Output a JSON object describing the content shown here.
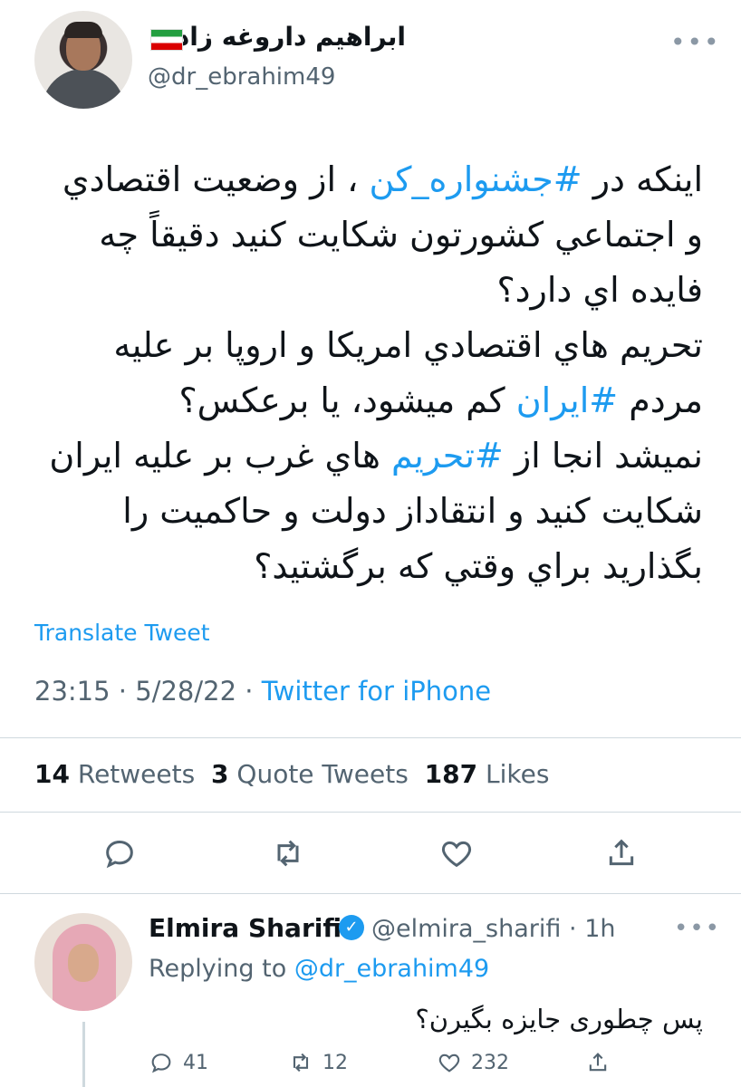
{
  "tweet": {
    "display_name": "ابراهیم داروغه زاده",
    "handle": "@dr_ebrahim49",
    "text_line1_pre": "اینکه در ",
    "hashtag1": "#جشنواره_کن",
    "text_line1_post": " ، از وضعیت اقتصادي",
    "text_line2": "و اجتماعي کشورتون شکایت کنید دقیقاً چه",
    "text_line3": "فایده اي دارد؟",
    "text_line4": "تحریم هاي اقتصادي امریکا و اروپا بر علیه",
    "text_line5_pre": "مردم ",
    "hashtag2": "#ایران",
    "text_line5_post": " کم میشود، یا برعکس؟",
    "text_line6_pre": "نمیشد انجا از ",
    "hashtag3": "#تحریم",
    "text_line6_post": " هاي غرب بر علیه ایران",
    "text_line7": "شکایت کنید و انتقاداز دولت و حاکمیت را",
    "text_line8": "بگذارید براي وقتي که برگشتید؟",
    "translate_label": "Translate Tweet",
    "time": "23:15",
    "date": "5/28/22",
    "separator": "·",
    "source": "Twitter for iPhone",
    "retweets_count": "14",
    "retweets_label": "Retweets",
    "quotes_count": "3",
    "quotes_label": "Quote Tweets",
    "likes_count": "187",
    "likes_label": "Likes",
    "more_icon": "more-dots-icon"
  },
  "reply": {
    "display_name": "Elmira Sharifi",
    "handle": "@elmira_sharifi",
    "separator": "·",
    "age": "1h",
    "replying_prefix": "Replying to",
    "replying_to": "@dr_ebrahim49",
    "text": "پس چطوری جایزه بگیرن؟",
    "reply_count": "41",
    "retweet_count": "12",
    "like_count": "232"
  },
  "colors": {
    "accent": "#1d9bf0",
    "secondary_text": "#536471",
    "divider": "#cfd9de"
  }
}
